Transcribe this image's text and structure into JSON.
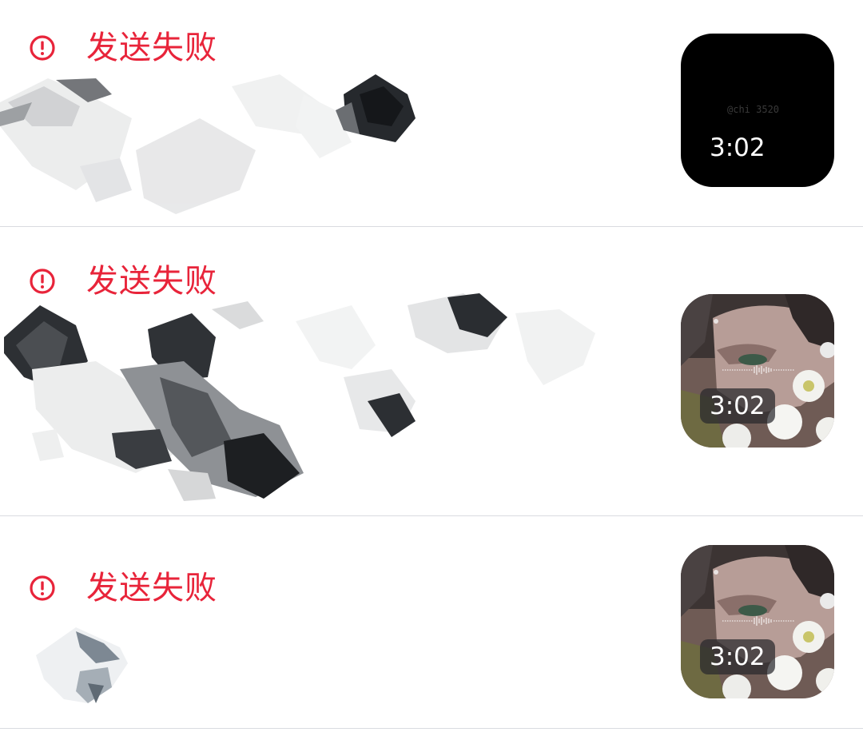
{
  "messages": [
    {
      "status": "发送失败",
      "thumbnail": {
        "style": "black",
        "watermark": "@chi 3520",
        "duration": "3:02"
      }
    },
    {
      "status": "发送失败",
      "thumbnail": {
        "style": "photo",
        "duration": "3:02"
      }
    },
    {
      "status": "发送失败",
      "thumbnail": {
        "style": "photo",
        "duration": "3:02"
      }
    }
  ],
  "colors": {
    "error_red": "#e8243a",
    "divider": "#d9dbe0",
    "thumb_black": "#000000"
  },
  "icons": {
    "status_icon": "exclamation-circle-icon"
  }
}
